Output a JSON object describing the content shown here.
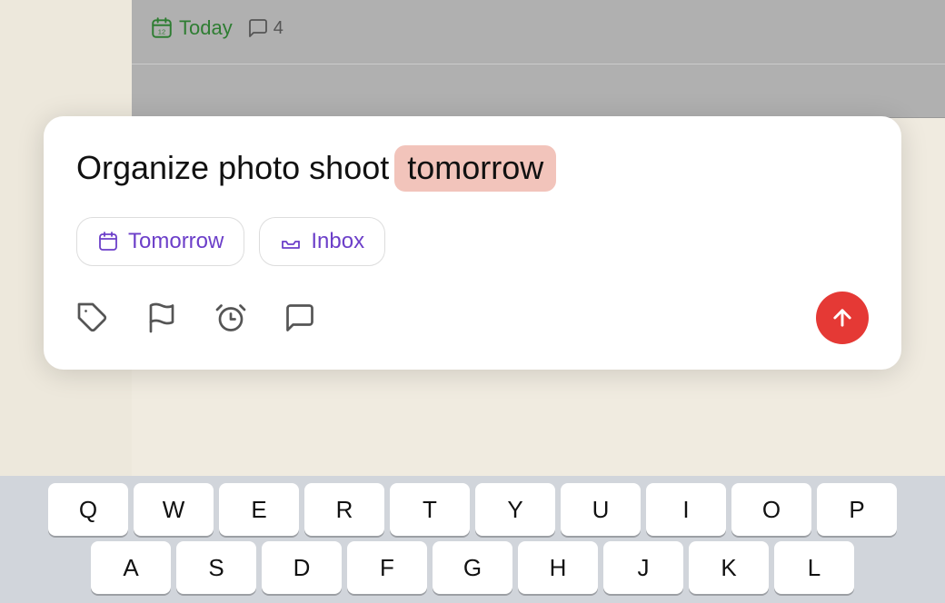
{
  "app": {
    "today_label": "Today",
    "comment_label": "4",
    "today_icon": "calendar-icon",
    "comment_icon": "comment-icon"
  },
  "card": {
    "task_prefix": "Organize photo shoot",
    "task_highlight": "tomorrow",
    "chips": [
      {
        "id": "tomorrow",
        "label": "Tomorrow",
        "icon": "calendar-chip-icon"
      },
      {
        "id": "inbox",
        "label": "Inbox",
        "icon": "inbox-chip-icon"
      }
    ],
    "icons": [
      {
        "id": "tag",
        "name": "tag-icon"
      },
      {
        "id": "flag",
        "name": "flag-icon"
      },
      {
        "id": "alarm",
        "name": "alarm-icon"
      },
      {
        "id": "comment",
        "name": "comment-toolbar-icon"
      }
    ],
    "send_button_label": "send"
  },
  "keyboard": {
    "row1": [
      "Q",
      "W",
      "E",
      "R",
      "T",
      "Y",
      "U",
      "I",
      "O",
      "P"
    ],
    "row2": [
      "A",
      "S",
      "D",
      "F",
      "G",
      "H",
      "J",
      "K",
      "L"
    ]
  },
  "colors": {
    "highlight_bg": "#f2c4bb",
    "chip_text": "#6c3fc9",
    "send_btn": "#e53935",
    "today_green": "#2e7d32"
  }
}
